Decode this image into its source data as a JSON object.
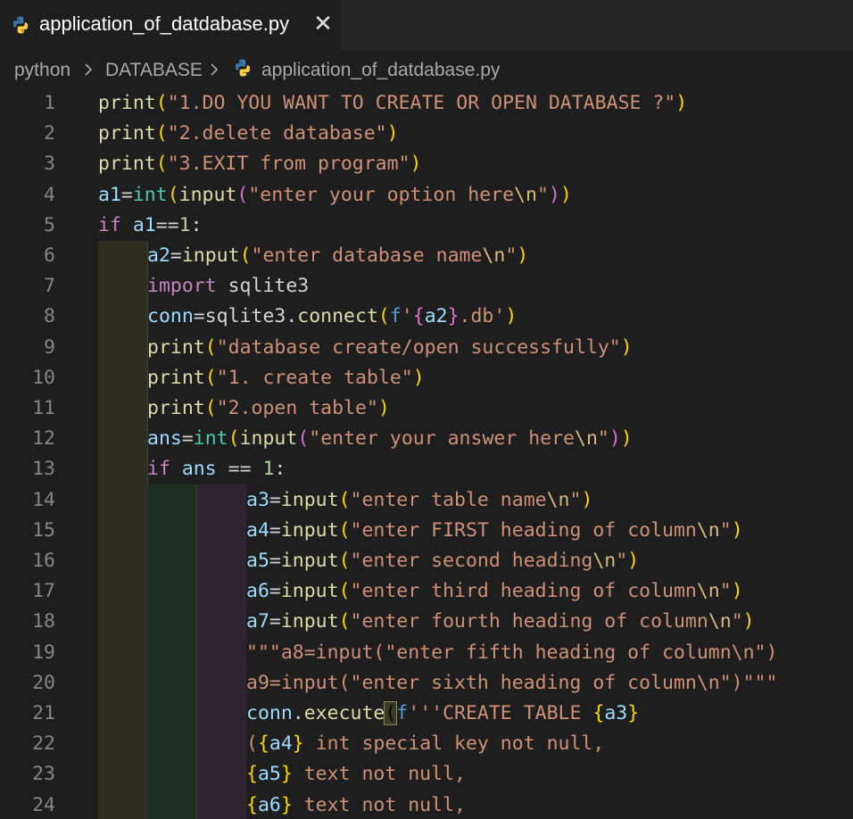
{
  "tab": {
    "filename": "application_of_datdabase.py",
    "close_glyph": "✕",
    "icon": "python-icon"
  },
  "breadcrumb": {
    "items": [
      "python",
      "DATABASE",
      "application_of_datdabase.py"
    ],
    "separator_icon": "chevron-right-icon"
  },
  "editor": {
    "line_numbers": [
      "1",
      "2",
      "3",
      "4",
      "5",
      "6",
      "7",
      "8",
      "9",
      "10",
      "11",
      "12",
      "13",
      "14",
      "15",
      "16",
      "17",
      "18",
      "19",
      "20",
      "21",
      "22",
      "23",
      "24"
    ],
    "lines": [
      {
        "indent": 0,
        "tokens": [
          [
            "f",
            "print"
          ],
          [
            "p1",
            "("
          ],
          [
            "s",
            "\"1.DO YOU WANT TO CREATE OR OPEN DATABASE ?\""
          ],
          [
            "p1",
            ")"
          ]
        ]
      },
      {
        "indent": 0,
        "tokens": [
          [
            "f",
            "print"
          ],
          [
            "p1",
            "("
          ],
          [
            "s",
            "\"2.delete database\""
          ],
          [
            "p1",
            ")"
          ]
        ]
      },
      {
        "indent": 0,
        "tokens": [
          [
            "f",
            "print"
          ],
          [
            "p1",
            "("
          ],
          [
            "s",
            "\"3.EXIT from program\""
          ],
          [
            "p1",
            ")"
          ]
        ]
      },
      {
        "indent": 0,
        "tokens": [
          [
            "v",
            "a1"
          ],
          [
            "t",
            "="
          ],
          [
            "b",
            "int"
          ],
          [
            "p1",
            "("
          ],
          [
            "f",
            "input"
          ],
          [
            "p2",
            "("
          ],
          [
            "s",
            "\"enter your option here"
          ],
          [
            "e",
            "\\n"
          ],
          [
            "s",
            "\""
          ],
          [
            "p2",
            ")"
          ],
          [
            "p1",
            ")"
          ]
        ]
      },
      {
        "indent": 0,
        "tokens": [
          [
            "k",
            "if"
          ],
          [
            "t",
            " "
          ],
          [
            "v",
            "a1"
          ],
          [
            "t",
            "=="
          ],
          [
            "n",
            "1"
          ],
          [
            "t",
            ":"
          ]
        ]
      },
      {
        "indent": 1,
        "tokens": [
          [
            "v",
            "a2"
          ],
          [
            "t",
            "="
          ],
          [
            "f",
            "input"
          ],
          [
            "p1",
            "("
          ],
          [
            "s",
            "\"enter database name"
          ],
          [
            "e",
            "\\n"
          ],
          [
            "s",
            "\""
          ],
          [
            "p1",
            ")"
          ]
        ]
      },
      {
        "indent": 1,
        "tokens": [
          [
            "k",
            "import"
          ],
          [
            "t",
            " sqlite3"
          ]
        ]
      },
      {
        "indent": 1,
        "tokens": [
          [
            "v",
            "conn"
          ],
          [
            "t",
            "=sqlite3."
          ],
          [
            "f",
            "connect"
          ],
          [
            "p1",
            "("
          ],
          [
            "sf",
            "f"
          ],
          [
            "s",
            "'"
          ],
          [
            "p2",
            "{"
          ],
          [
            "v",
            "a2"
          ],
          [
            "p2",
            "}"
          ],
          [
            "s",
            ".db'"
          ],
          [
            "p1",
            ")"
          ]
        ]
      },
      {
        "indent": 1,
        "tokens": [
          [
            "f",
            "print"
          ],
          [
            "p1",
            "("
          ],
          [
            "s",
            "\"database create/open successfully\""
          ],
          [
            "p1",
            ")"
          ]
        ]
      },
      {
        "indent": 1,
        "tokens": [
          [
            "f",
            "print"
          ],
          [
            "p1",
            "("
          ],
          [
            "s",
            "\"1. create table\""
          ],
          [
            "p1",
            ")"
          ]
        ]
      },
      {
        "indent": 1,
        "tokens": [
          [
            "f",
            "print"
          ],
          [
            "p1",
            "("
          ],
          [
            "s",
            "\"2.open table\""
          ],
          [
            "p1",
            ")"
          ]
        ]
      },
      {
        "indent": 1,
        "tokens": [
          [
            "v",
            "ans"
          ],
          [
            "t",
            "="
          ],
          [
            "b",
            "int"
          ],
          [
            "p1",
            "("
          ],
          [
            "f",
            "input"
          ],
          [
            "p2",
            "("
          ],
          [
            "s",
            "\"enter your answer here"
          ],
          [
            "e",
            "\\n"
          ],
          [
            "s",
            "\""
          ],
          [
            "p2",
            ")"
          ],
          [
            "p1",
            ")"
          ]
        ]
      },
      {
        "indent": 1,
        "tokens": [
          [
            "k",
            "if"
          ],
          [
            "t",
            " "
          ],
          [
            "v",
            "ans"
          ],
          [
            "t",
            " == "
          ],
          [
            "n",
            "1"
          ],
          [
            "t",
            ":"
          ]
        ]
      },
      {
        "indent": 2,
        "tokens": [
          [
            "v",
            "a3"
          ],
          [
            "t",
            "="
          ],
          [
            "f",
            "input"
          ],
          [
            "p1",
            "("
          ],
          [
            "s",
            "\"enter table name"
          ],
          [
            "e",
            "\\n"
          ],
          [
            "s",
            "\""
          ],
          [
            "p1",
            ")"
          ]
        ]
      },
      {
        "indent": 2,
        "tokens": [
          [
            "v",
            "a4"
          ],
          [
            "t",
            "="
          ],
          [
            "f",
            "input"
          ],
          [
            "p1",
            "("
          ],
          [
            "s",
            "\"enter FIRST heading of column"
          ],
          [
            "e",
            "\\n"
          ],
          [
            "s",
            "\""
          ],
          [
            "p1",
            ")"
          ]
        ]
      },
      {
        "indent": 2,
        "tokens": [
          [
            "v",
            "a5"
          ],
          [
            "t",
            "="
          ],
          [
            "f",
            "input"
          ],
          [
            "p1",
            "("
          ],
          [
            "s",
            "\"enter second heading"
          ],
          [
            "e",
            "\\n"
          ],
          [
            "s",
            "\""
          ],
          [
            "p1",
            ")"
          ]
        ]
      },
      {
        "indent": 2,
        "tokens": [
          [
            "v",
            "a6"
          ],
          [
            "t",
            "="
          ],
          [
            "f",
            "input"
          ],
          [
            "p1",
            "("
          ],
          [
            "s",
            "\"enter third heading of column"
          ],
          [
            "e",
            "\\n"
          ],
          [
            "s",
            "\""
          ],
          [
            "p1",
            ")"
          ]
        ]
      },
      {
        "indent": 2,
        "tokens": [
          [
            "v",
            "a7"
          ],
          [
            "t",
            "="
          ],
          [
            "f",
            "input"
          ],
          [
            "p1",
            "("
          ],
          [
            "s",
            "\"enter fourth heading of column"
          ],
          [
            "e",
            "\\n"
          ],
          [
            "s",
            "\""
          ],
          [
            "p1",
            ")"
          ]
        ]
      },
      {
        "indent": 2,
        "tokens": [
          [
            "s",
            "\"\"\"a8=input(\"enter fifth heading of column\\n\")"
          ]
        ]
      },
      {
        "indent": 2,
        "tokens": [
          [
            "s",
            "a9=input(\"enter sixth heading of column\\n\")\"\"\""
          ]
        ]
      },
      {
        "indent": 2,
        "tokens": [
          [
            "v",
            "conn"
          ],
          [
            "t",
            "."
          ],
          [
            "f",
            "execute"
          ],
          [
            "bm",
            "("
          ],
          [
            "sf",
            "f"
          ],
          [
            "s",
            "'''CREATE TABLE "
          ],
          [
            "p1",
            "{"
          ],
          [
            "v",
            "a3"
          ],
          [
            "p1",
            "}"
          ]
        ]
      },
      {
        "indent": 2,
        "tokens": [
          [
            "s",
            "("
          ],
          [
            "p1",
            "{"
          ],
          [
            "v",
            "a4"
          ],
          [
            "p1",
            "}"
          ],
          [
            "s",
            " int special key not null,"
          ]
        ]
      },
      {
        "indent": 2,
        "tokens": [
          [
            "p1",
            "{"
          ],
          [
            "v",
            "a5"
          ],
          [
            "p1",
            "}"
          ],
          [
            "s",
            " text not null,"
          ]
        ]
      },
      {
        "indent": 2,
        "tokens": [
          [
            "p1",
            "{"
          ],
          [
            "v",
            "a6"
          ],
          [
            "p1",
            "}"
          ],
          [
            "s",
            " text not null,"
          ]
        ]
      }
    ]
  }
}
